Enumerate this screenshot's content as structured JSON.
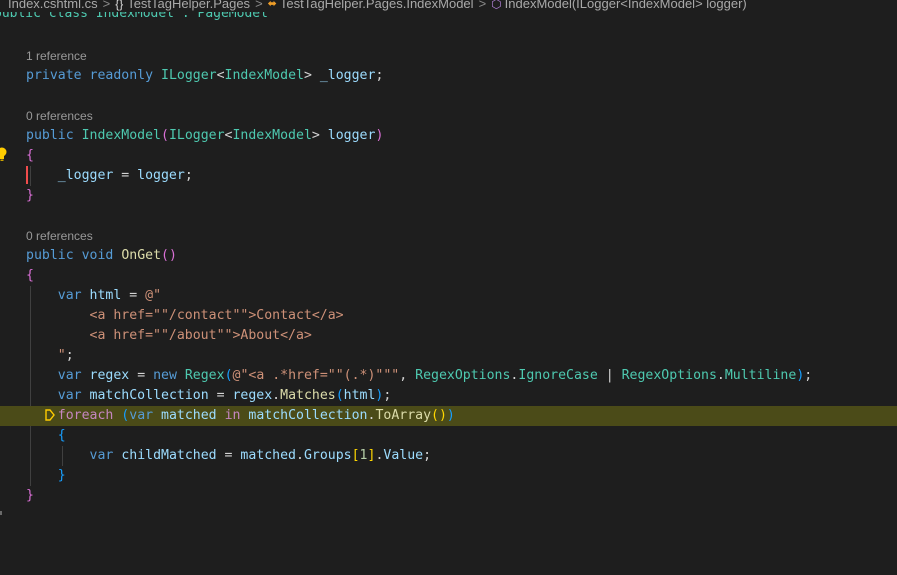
{
  "breadcrumb": {
    "file": "Index.cshtml.cs",
    "namespace": "TestTagHelper.Pages",
    "class": "TestTagHelper.Pages.IndexModel",
    "member": "IndexModel(ILogger<IndexModel> logger)"
  },
  "partial_line": "public class IndexModel : PageModel",
  "codelens": {
    "ref1": "1 reference",
    "ref2": "0 references",
    "ref3": "0 references"
  },
  "colors": {
    "keyword": "#569cd6",
    "control": "#c586c0",
    "type": "#4ec9b0",
    "function": "#dcdcaa",
    "variable": "#9cdcfe",
    "string": "#ce9178",
    "number": "#b5cea8",
    "highlight": "#4b4b18"
  },
  "icons": [
    "chevron-right-icon",
    "namespace-braces-icon",
    "class-icon",
    "method-cube-icon",
    "lightbulb-icon",
    "breakpoint-arrow-icon"
  ],
  "code": {
    "l1": {
      "private": "private",
      "readonly": "readonly",
      "ilogger": "ILogger",
      "lt": "<",
      "model": "IndexModel",
      "gt": ">",
      "field": "_logger",
      "semi": ";"
    },
    "l2": {
      "public": "public",
      "ctor": "IndexModel",
      "lp": "(",
      "ilogger": "ILogger",
      "lt": "<",
      "model": "IndexModel",
      "gt": ">",
      "param": "logger",
      "rp": ")"
    },
    "l3": {
      "brace": "{"
    },
    "l4": {
      "field": "_logger",
      "eq": " = ",
      "param": "logger",
      "semi": ";"
    },
    "l5": {
      "brace": "}"
    },
    "l6": {
      "public": "public",
      "void": "void",
      "name": "OnGet",
      "parens": "()"
    },
    "l7": {
      "brace": "{"
    },
    "l8": {
      "var": "var",
      "name": "html",
      "eq": " = ",
      "str": "@\""
    },
    "l9": {
      "str": "<a href=\"\"/contact\"\">Contact</a>"
    },
    "l10": {
      "str": "<a href=\"\"/about\"\">About</a>"
    },
    "l11": {
      "str": "\"",
      "semi": ";"
    },
    "l12": {
      "var": "var",
      "name": "regex",
      "eq": " = ",
      "new": "new",
      "type": "Regex",
      "lp": "(",
      "str": "@\"<a .*href=\"\"(.*)\"\"\"",
      "comma": ", ",
      "opt1": "RegexOptions",
      "dot1": ".",
      "mem1": "IgnoreCase",
      "pipe": " | ",
      "opt2": "RegexOptions",
      "dot2": ".",
      "mem2": "Multiline",
      "rp": ")",
      "semi": ";"
    },
    "l13": {
      "var": "var",
      "name": "matchCollection",
      "eq": " = ",
      "obj": "regex",
      "dot": ".",
      "fn": "Matches",
      "lp": "(",
      "arg": "html",
      "rp": ")",
      "semi": ";"
    },
    "l14": {
      "foreach": "foreach",
      "lp": "(",
      "var": "var",
      "name": "matched",
      "in": "in",
      "coll": "matchCollection",
      "dot": ".",
      "fn": "ToArray",
      "parens": "()",
      "rp": ")"
    },
    "l15": {
      "brace": "{"
    },
    "l16": {
      "var": "var",
      "name": "childMatched",
      "eq": " = ",
      "obj": "matched",
      "dot": ".",
      "prop": "Groups",
      "lb": "[",
      "num": "1",
      "rb": "]",
      "dot2": ".",
      "prop2": "Value",
      "semi": ";"
    },
    "l17": {
      "brace": "}"
    },
    "l18": {
      "brace": "}"
    }
  }
}
